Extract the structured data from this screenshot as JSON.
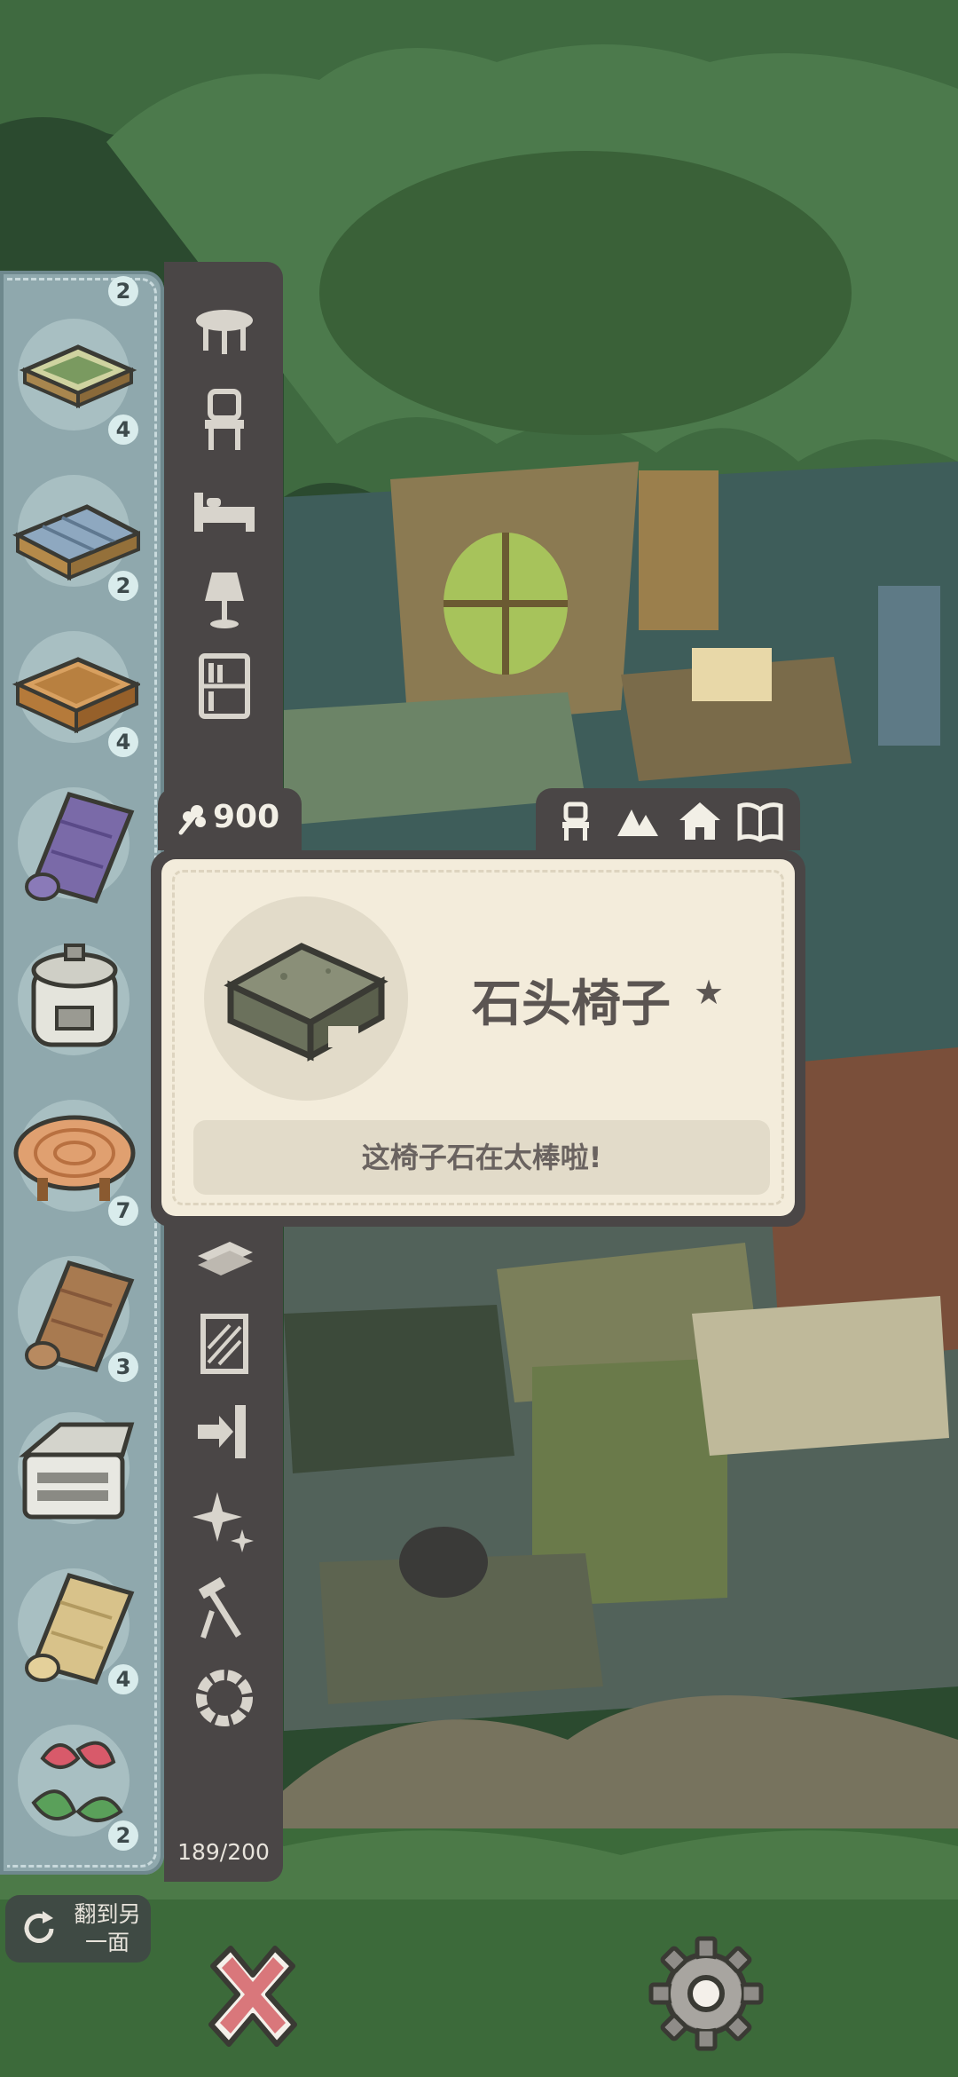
{
  "inventory": {
    "top_partial_badge": "2",
    "items": [
      {
        "icon": "tatami-table-icon",
        "count": "4"
      },
      {
        "icon": "blue-plank-table-icon",
        "count": "2"
      },
      {
        "icon": "wooden-box-icon",
        "count": "4"
      },
      {
        "icon": "purple-rug-icon",
        "count": ""
      },
      {
        "icon": "rice-cooker-icon",
        "count": ""
      },
      {
        "icon": "tree-stump-table-icon",
        "count": "7"
      },
      {
        "icon": "wood-rug-icon",
        "count": "3"
      },
      {
        "icon": "printer-icon",
        "count": ""
      },
      {
        "icon": "light-wood-rug-icon",
        "count": "4"
      },
      {
        "icon": "anthurium-plant-icon",
        "count": "2"
      }
    ]
  },
  "categories": [
    "table-category-icon",
    "chair-category-icon",
    "bed-category-icon",
    "lamp-category-icon",
    "bookshelf-category-icon",
    "floor-category-icon",
    "wallpaper-category-icon",
    "door-category-icon",
    "sparkle-category-icon",
    "tools-category-icon",
    "wreath-category-icon"
  ],
  "capacity": "189/200",
  "price": {
    "icon": "clover-icon",
    "value": "900"
  },
  "filter_tabs": [
    "chair-filter-icon",
    "mountain-filter-icon",
    "house-filter-icon",
    "book-filter-icon"
  ],
  "item_card": {
    "name": "石头椅子",
    "star": "★",
    "description": "这椅子石在太棒啦!",
    "image": "stone-chair-icon"
  },
  "flip_button": {
    "label_line1": "翻到另",
    "label_line2": "一面"
  },
  "colors": {
    "panel_dark": "#4a4646",
    "inventory_bg": "#8fa8ad",
    "card_bg": "#f3ecdb",
    "close_red": "#d9777b"
  }
}
